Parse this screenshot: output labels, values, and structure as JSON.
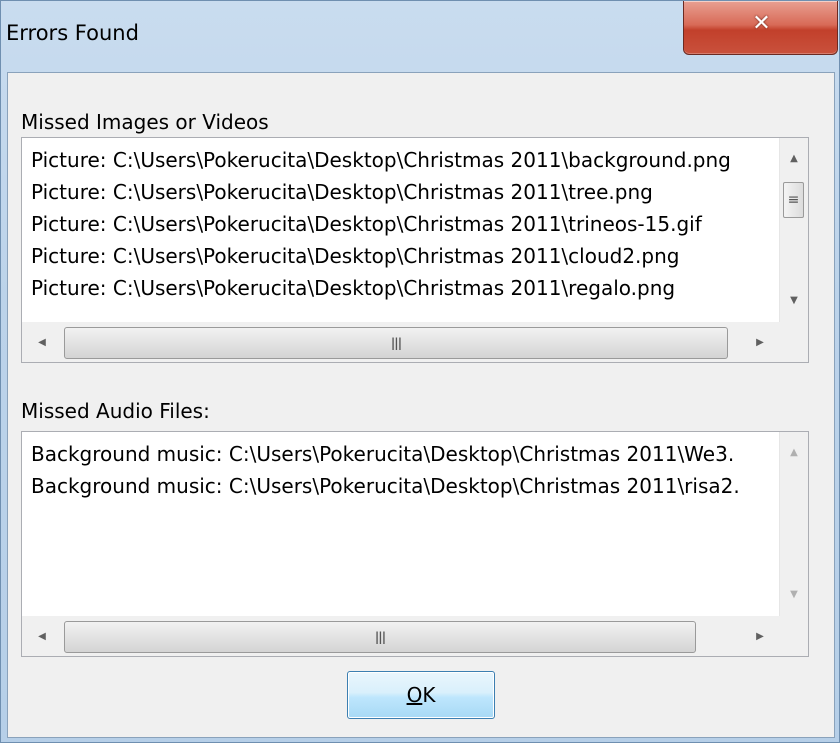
{
  "window": {
    "title": "Errors Found",
    "close_glyph": "✕"
  },
  "images_section": {
    "label": "Missed Images or Videos",
    "items": [
      "Picture: C:\\Users\\Pokerucita\\Desktop\\Christmas 2011\\background.png",
      "Picture: C:\\Users\\Pokerucita\\Desktop\\Christmas 2011\\tree.png",
      "Picture: C:\\Users\\Pokerucita\\Desktop\\Christmas 2011\\trineos-15.gif",
      "Picture: C:\\Users\\Pokerucita\\Desktop\\Christmas 2011\\cloud2.png",
      "Picture: C:\\Users\\Pokerucita\\Desktop\\Christmas 2011\\regalo.png"
    ]
  },
  "audio_section": {
    "label": "Missed Audio Files:",
    "items": [
      "Background music: C:\\Users\\Pokerucita\\Desktop\\Christmas 2011\\We3.",
      "Background music: C:\\Users\\Pokerucita\\Desktop\\Christmas 2011\\risa2."
    ]
  },
  "buttons": {
    "ok_mnemonic": "O",
    "ok_rest": "K"
  },
  "icons": {
    "close": "close-icon",
    "scroll_up": "arrow-up-icon",
    "scroll_down": "arrow-down-icon",
    "scroll_left": "arrow-left-icon",
    "scroll_right": "arrow-right-icon",
    "grip": "grip-icon"
  },
  "colors": {
    "close_button": "#c9513c",
    "ok_button_border": "#3c7fb1",
    "list_background": "#ffffff",
    "dialog_background": "#f0f0f0"
  }
}
